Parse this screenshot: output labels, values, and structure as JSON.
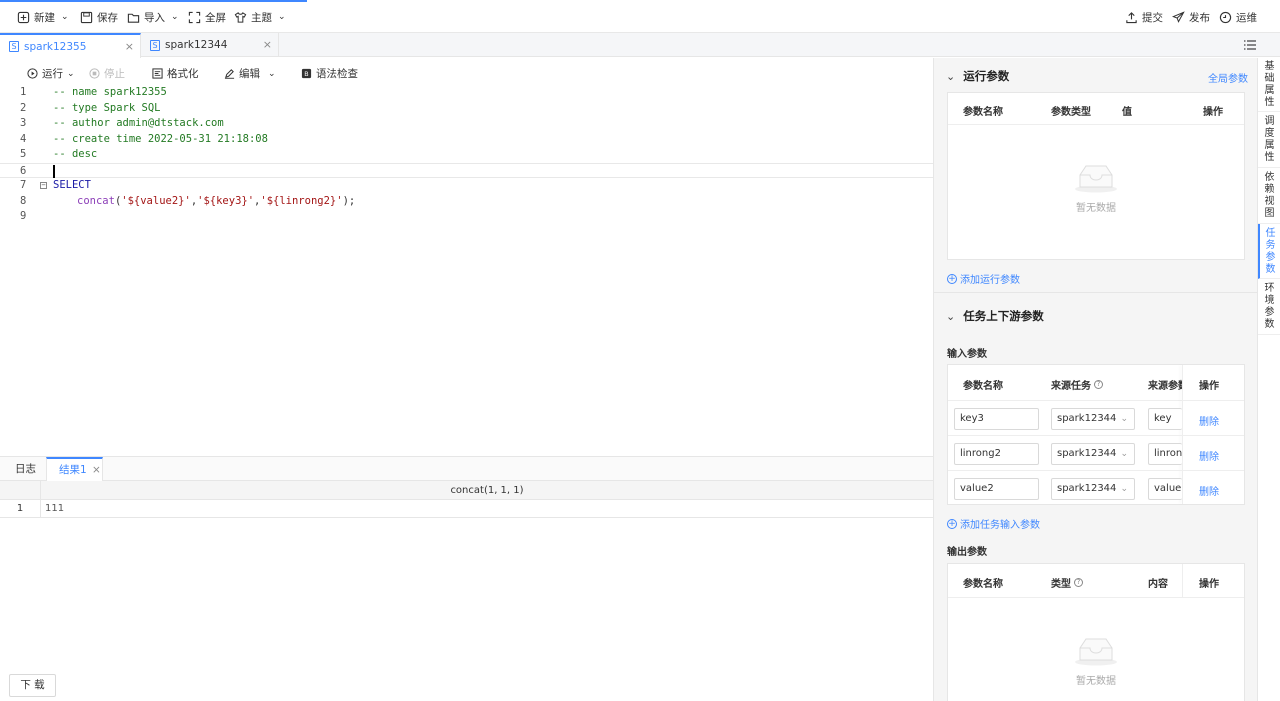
{
  "toolbar": {
    "new": "新建",
    "save": "保存",
    "import": "导入",
    "fullscreen": "全屏",
    "theme": "主题",
    "submit": "提交",
    "publish": "发布",
    "ops": "运维"
  },
  "tabs": [
    {
      "label": "spark12355",
      "active": true
    },
    {
      "label": "spark12344",
      "active": false
    }
  ],
  "editor_toolbar": {
    "run": "运行",
    "stop": "停止",
    "format": "格式化",
    "edit": "编辑",
    "syntax_check": "语法检查"
  },
  "code": {
    "line_numbers": [
      "1",
      "2",
      "3",
      "4",
      "5",
      "6",
      "7",
      "8",
      "9"
    ],
    "comment1": "-- name spark12355",
    "comment2": "-- type Spark SQL",
    "comment3": "-- author admin@dtstack.com",
    "comment4": "-- create time 2022-05-31 21:18:08",
    "comment5": "-- desc",
    "select_kw": "SELECT",
    "func": "concat",
    "arg1": "'${value2}'",
    "arg2": "'${key3}'",
    "arg3": "'${linrong2}'",
    "open_paren": "(",
    "comma": ",",
    "close_paren": ");"
  },
  "results": {
    "log_tab": "日志",
    "result_tab": "结果1",
    "column": "concat(1, 1, 1)",
    "row_number": "1",
    "row_value": "111",
    "download": "下 载"
  },
  "right_panel": {
    "run_params_title": "运行参数",
    "global_params": "全局参数",
    "run_params_headers": [
      "参数名称",
      "参数类型",
      "值",
      "操作"
    ],
    "empty_text": "暂无数据",
    "add_run_param": "添加运行参数",
    "upstream_title": "任务上下游参数",
    "input_params": "输入参数",
    "input_headers": [
      "参数名称",
      "来源任务",
      "来源参数",
      "操作"
    ],
    "input_rows": [
      {
        "name": "key3",
        "task": "spark12344",
        "source": "key",
        "action": "删除"
      },
      {
        "name": "linrong2",
        "task": "spark12344",
        "source": "linrong",
        "action": "删除"
      },
      {
        "name": "value2",
        "task": "spark12344",
        "source": "value",
        "action": "删除"
      }
    ],
    "add_input_param": "添加任务输入参数",
    "output_params": "输出参数",
    "output_headers": [
      "参数名称",
      "类型",
      "内容",
      "操作"
    ]
  },
  "side_tabs": [
    {
      "label": "基础属性",
      "active": false
    },
    {
      "label": "调度属性",
      "active": false
    },
    {
      "label": "依赖视图",
      "active": false
    },
    {
      "label": "任务参数",
      "active": true
    },
    {
      "label": "环境参数",
      "active": false
    }
  ],
  "colors": {
    "accent": "#3f87ff"
  }
}
